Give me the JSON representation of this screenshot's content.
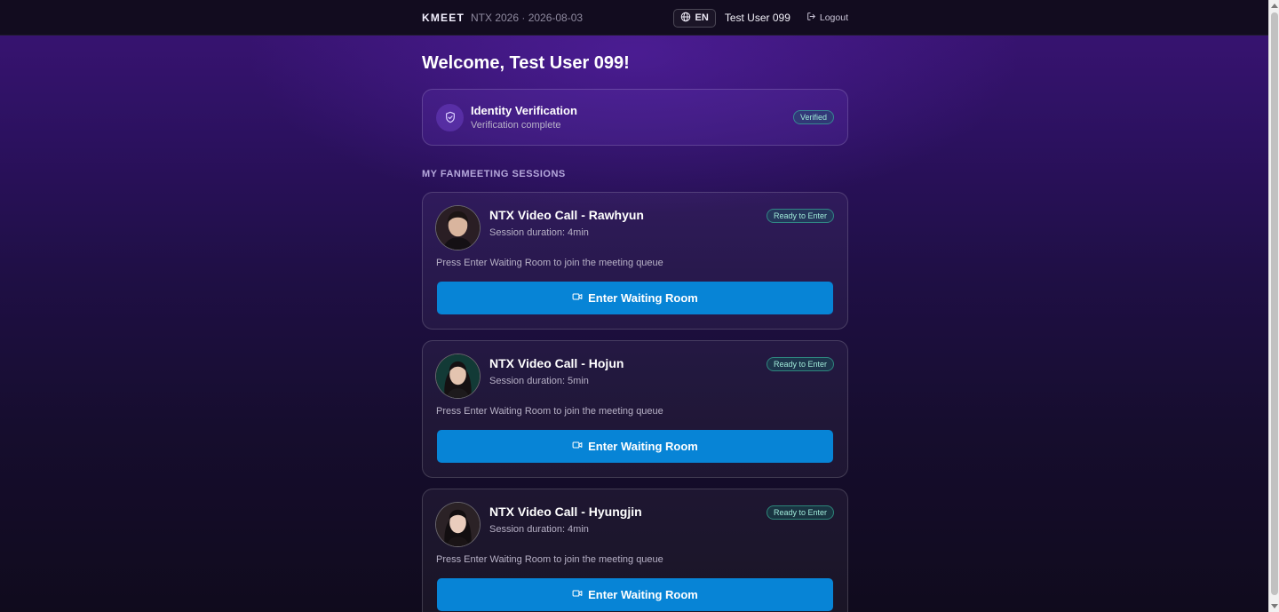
{
  "header": {
    "brand": "KMEET",
    "event_meta": "NTX 2026 · 2026-08-03",
    "language_label": "EN",
    "user_name": "Test User 099",
    "logout_label": "Logout"
  },
  "welcome": "Welcome, Test User 099!",
  "verification": {
    "title": "Identity Verification",
    "subtitle": "Verification complete",
    "status": "Verified"
  },
  "sessions_heading": "MY FANMEETING SESSIONS",
  "sessions": [
    {
      "title": "NTX Video Call - Rawhyun",
      "duration": "Session duration: 4min",
      "status": "Ready to Enter",
      "hint": "Press Enter Waiting Room to join the meeting queue",
      "button": "Enter Waiting Room"
    },
    {
      "title": "NTX Video Call - Hojun",
      "duration": "Session duration: 5min",
      "status": "Ready to Enter",
      "hint": "Press Enter Waiting Room to join the meeting queue",
      "button": "Enter Waiting Room"
    },
    {
      "title": "NTX Video Call - Hyungjin",
      "duration": "Session duration: 4min",
      "status": "Ready to Enter",
      "hint": "Press Enter Waiting Room to join the meeting queue",
      "button": "Enter Waiting Room"
    }
  ],
  "colors": {
    "primary_button": "#0784d6",
    "status_teal": "#9fe9d8",
    "background_purple": "#2c1160"
  },
  "icons": {
    "language": "globe-icon",
    "logout": "logout-icon",
    "verification": "shield-check-icon",
    "enter_button": "video-camera-icon"
  }
}
